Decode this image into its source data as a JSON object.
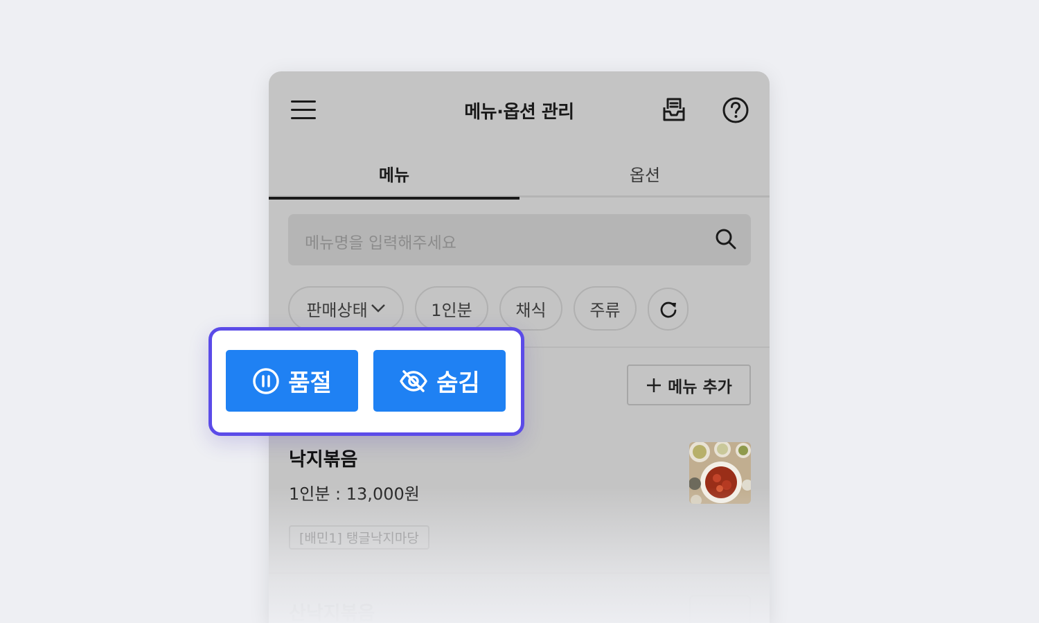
{
  "header": {
    "title": "메뉴·옵션 관리"
  },
  "tabs": [
    {
      "label": "메뉴",
      "active": true
    },
    {
      "label": "옵션",
      "active": false
    }
  ],
  "search": {
    "placeholder": "메뉴명을 입력해주세요"
  },
  "filters": {
    "status_label": "판매상태",
    "chips": [
      "1인분",
      "채식",
      "주류"
    ]
  },
  "actions": {
    "soldout_label": "품절",
    "hide_label": "숨김",
    "add_menu_label": "메뉴 추가"
  },
  "menu_items": [
    {
      "name": "낙지볶음",
      "price": "1인분 : 13,000원",
      "tag": "[배민1] 탱글낙지마당"
    },
    {
      "name": "산낙지볶음"
    }
  ],
  "colors": {
    "accent": "#1f81f3",
    "highlight_border": "#5b4be8",
    "overlay_gray": "#c4c4c4"
  }
}
